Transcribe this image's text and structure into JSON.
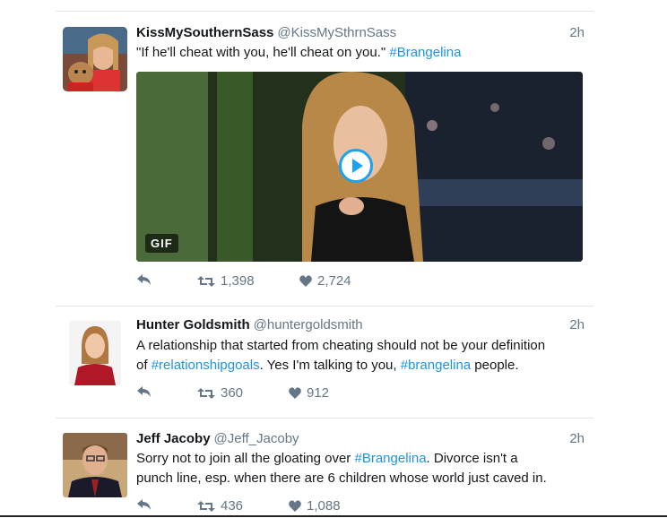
{
  "tweets": [
    {
      "name": "KissMySouthernSass",
      "handle": "@KissMySthrnSass",
      "time": "2h",
      "text_before": "\"If he'll cheat with you, he'll cheat on you.\" ",
      "hashtag": "#Brangelina",
      "media_badge": "GIF",
      "retweets": "1,398",
      "likes": "2,724"
    },
    {
      "name": "Hunter Goldsmith",
      "handle": "@huntergoldsmith",
      "time": "2h",
      "line1": "A relationship that started from cheating should not be your definition",
      "line2_pre": "of ",
      "hashtag1": "#relationshipgoals",
      "line2_mid": ". Yes I'm talking to you, ",
      "hashtag2": "#brangelina",
      "line2_post": " people.",
      "retweets": "360",
      "likes": "912"
    },
    {
      "name": "Jeff Jacoby",
      "handle": "@Jeff_Jacoby",
      "time": "2h",
      "line1_pre": "Sorry not to join all the gloating over ",
      "hashtag": "#Brangelina",
      "line1_post": ". Divorce isn't a",
      "line2": "punch line, esp. when there are 6 children whose world just caved in.",
      "retweets": "436",
      "likes": "1,088"
    }
  ],
  "colors": {
    "link": "#1b95e0",
    "muted": "#657786",
    "divider": "#e1e8ed"
  },
  "icons": [
    "reply-icon",
    "retweet-icon",
    "like-icon",
    "play-icon"
  ]
}
